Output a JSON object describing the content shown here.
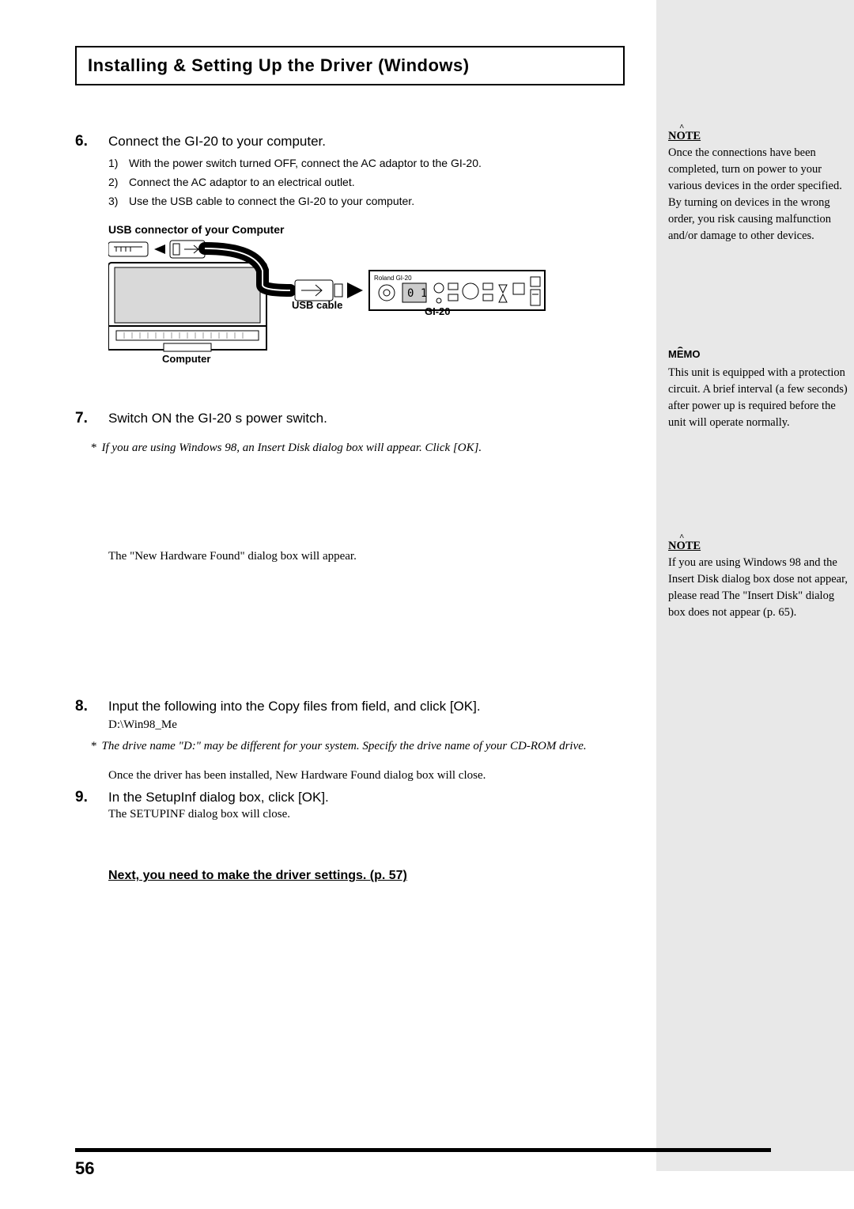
{
  "title": "Installing & Setting Up the Driver (Windows)",
  "step6": {
    "num": "6.",
    "lead": "Connect the GI-20 to your computer.",
    "items": [
      {
        "n": "1)",
        "t": "With the power switch turned OFF, connect the AC adaptor to the GI-20."
      },
      {
        "n": "2)",
        "t": "Connect the AC adaptor to an electrical outlet."
      },
      {
        "n": "3)",
        "t": "Use the USB cable to connect the GI-20 to your computer."
      }
    ]
  },
  "diagram": {
    "title": "USB connector of your Computer",
    "computer": "Computer",
    "usb_cable": "USB cable",
    "gi20": "GI-20",
    "device_brand": "Roland GI-20"
  },
  "step7": {
    "num": "7.",
    "lead": "Switch ON the GI-20 s power switch.",
    "note_star": "*",
    "note_text": "If you are using Windows 98, an Insert Disk dialog box will appear. Click [OK].",
    "found": "The \"New Hardware Found\" dialog box will appear."
  },
  "step8": {
    "num": "8.",
    "lead": "Input the following into the  Copy files from  field, and click [OK].",
    "path": "D:\\Win98_Me",
    "note_star": "*",
    "note_text": "The drive name \"D:\" may be different for your system. Specify the drive name of your CD-ROM drive.",
    "close": "Once the driver has been installed, New Hardware Found dialog box will close."
  },
  "step9": {
    "num": "9.",
    "lead": "In the SetupInf dialog box, click [OK].",
    "close": "The SETUPINF dialog box will close."
  },
  "next": "Next, you need to make the driver settings. (p. 57)",
  "side": {
    "note1_label": "NOTE",
    "note1_text": "Once the connections have been completed, turn on power to your various devices in the order specified. By turning on devices in the wrong order, you risk causing malfunction and/or damage to other devices.",
    "memo_label": "MEMO",
    "memo_text": "This unit is equipped with a protection circuit. A brief interval (a few seconds) after power up is required before the unit will operate normally.",
    "note2_label": "NOTE",
    "note2_text": "If you are using Windows 98 and the Insert Disk dialog box dose not appear, please read The \"Insert Disk\" dialog box does not appear (p. 65)."
  },
  "page_num": "56"
}
